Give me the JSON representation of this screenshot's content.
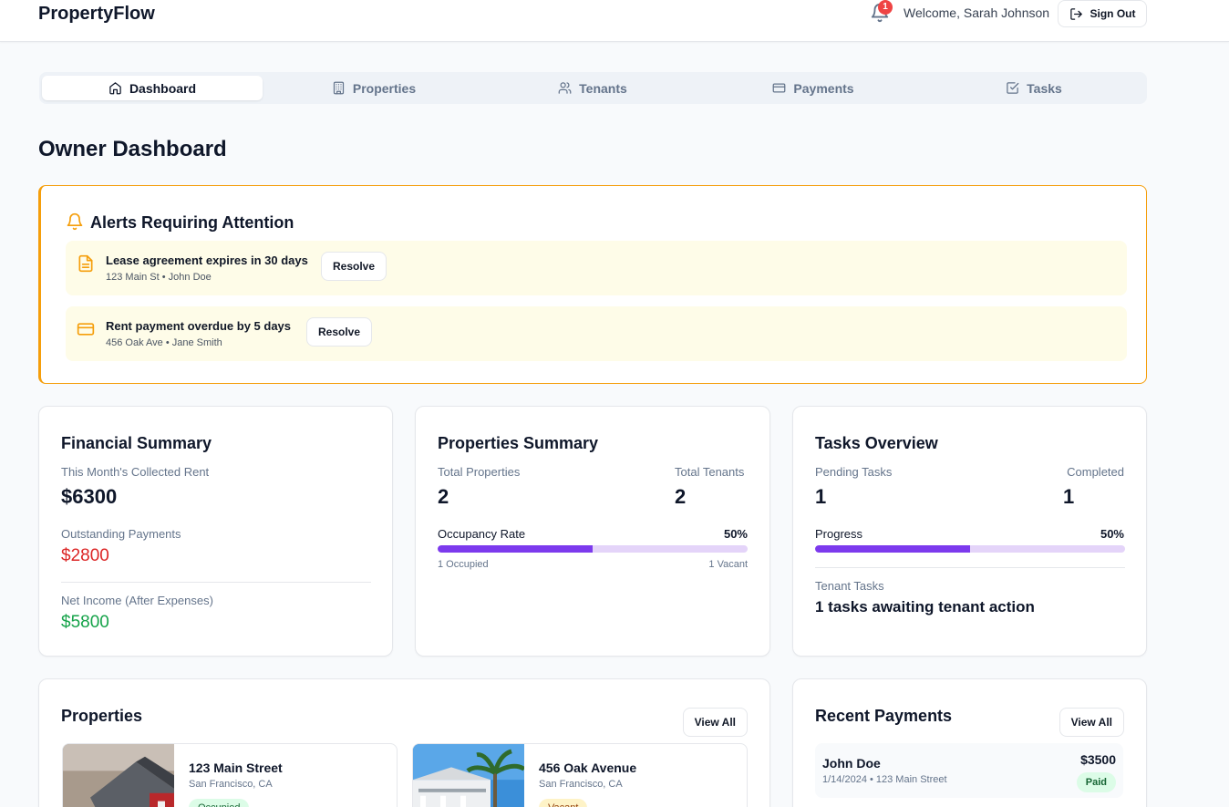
{
  "header": {
    "brand": "PropertyFlow",
    "notification_count": "1",
    "welcome": "Welcome, Sarah Johnson",
    "signout_label": "Sign Out"
  },
  "tabs": [
    {
      "label": "Dashboard",
      "icon": "home-icon",
      "active": true
    },
    {
      "label": "Properties",
      "icon": "building-icon",
      "active": false
    },
    {
      "label": "Tenants",
      "icon": "users-icon",
      "active": false
    },
    {
      "label": "Payments",
      "icon": "credit-card-icon",
      "active": false
    },
    {
      "label": "Tasks",
      "icon": "check-square-icon",
      "active": false
    }
  ],
  "page_title": "Owner Dashboard",
  "alerts": {
    "title": "Alerts Requiring Attention",
    "items": [
      {
        "title": "Lease agreement expires in 30 days",
        "sub": "123 Main St • John Doe",
        "action": "Resolve",
        "icon": "file-icon"
      },
      {
        "title": "Rent payment overdue by 5 days",
        "sub": "456 Oak Ave • Jane Smith",
        "action": "Resolve",
        "icon": "credit-card-icon"
      }
    ]
  },
  "financial": {
    "title": "Financial Summary",
    "collected_label": "This Month's Collected Rent",
    "collected_value": "$6300",
    "outstanding_label": "Outstanding Payments",
    "outstanding_value": "$2800",
    "net_label": "Net Income (After Expenses)",
    "net_value": "$5800"
  },
  "properties_summary": {
    "title": "Properties Summary",
    "total_properties_label": "Total Properties",
    "total_properties_value": "2",
    "total_tenants_label": "Total Tenants",
    "total_tenants_value": "2",
    "occupancy_label": "Occupancy Rate",
    "occupancy_value": "50%",
    "occupancy_fraction": 0.5,
    "occupied_label": "1 Occupied",
    "vacant_label": "1 Vacant"
  },
  "tasks_overview": {
    "title": "Tasks Overview",
    "pending_label": "Pending Tasks",
    "pending_value": "1",
    "completed_label": "Completed",
    "completed_value": "1",
    "progress_label": "Progress",
    "progress_value": "50%",
    "progress_fraction": 0.5,
    "tenant_tasks_label": "Tenant Tasks",
    "tenant_tasks_value": "1 tasks awaiting tenant action"
  },
  "properties": {
    "title": "Properties",
    "view_all": "View All",
    "items": [
      {
        "name": "123 Main Street",
        "location": "San Francisco, CA",
        "status": "Occupied"
      },
      {
        "name": "456 Oak Avenue",
        "location": "San Francisco, CA",
        "status": "Vacant"
      }
    ]
  },
  "recent_payments": {
    "title": "Recent Payments",
    "view_all": "View All",
    "items": [
      {
        "name": "John Doe",
        "meta": "1/14/2024 • 123 Main Street",
        "amount": "$3500",
        "status": "Paid"
      }
    ]
  },
  "colors": {
    "accent": "#7c3aed",
    "warning": "#f59e0b",
    "danger": "#dc2626",
    "success": "#16a34a"
  }
}
